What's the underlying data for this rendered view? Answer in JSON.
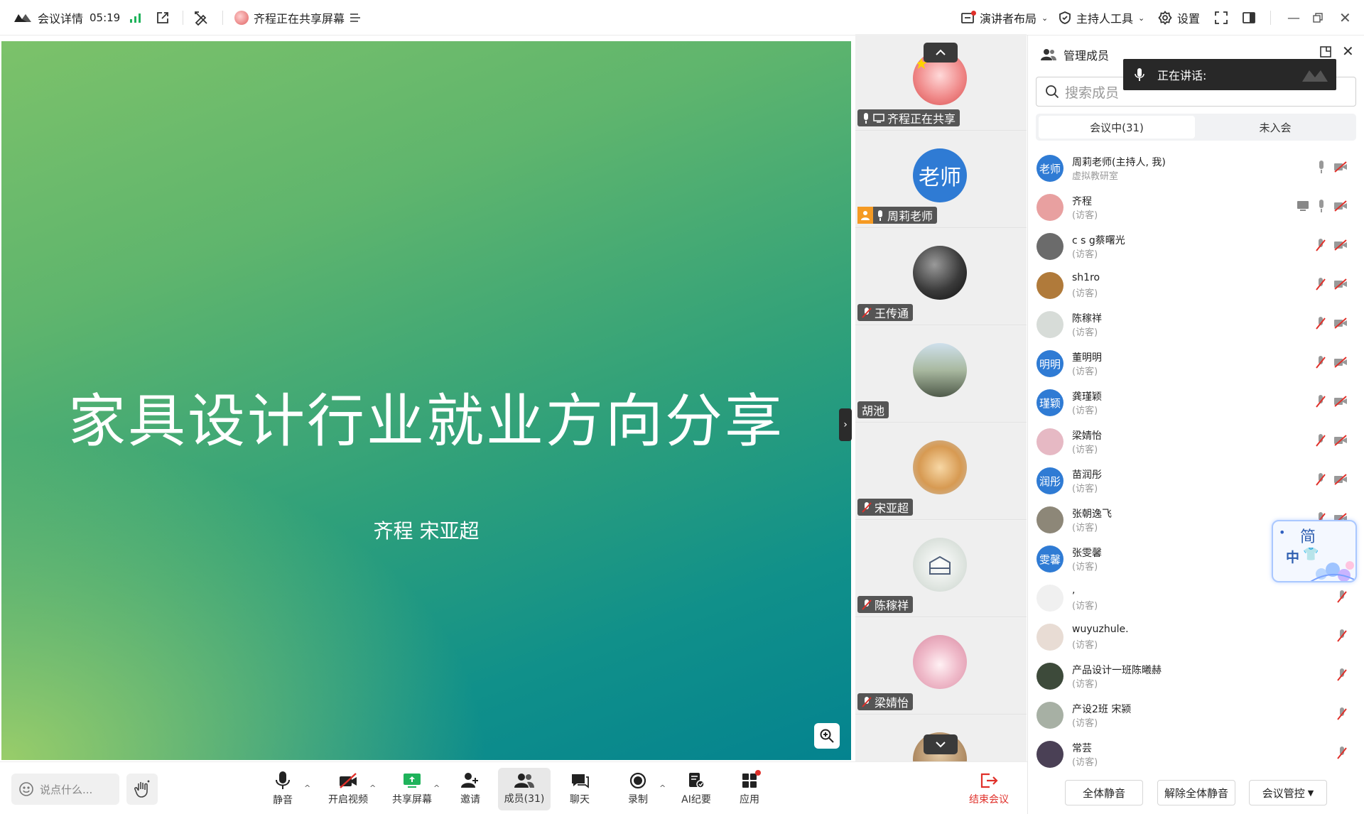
{
  "topbar": {
    "meeting_details": "会议详情",
    "elapsed": "05:19",
    "sharing_status": "齐程正在共享屏幕",
    "presenter_layout": "演讲者布局",
    "host_tools": "主持人工具",
    "settings": "设置"
  },
  "stage": {
    "slide_title": "家具设计行业就业方向分享",
    "slide_subtitle": "齐程 宋亚超"
  },
  "strip": {
    "tiles": [
      {
        "label": "齐程正在共享"
      },
      {
        "label": "周莉老师",
        "avatar_text": "老师"
      },
      {
        "label": "王传通"
      },
      {
        "label": "胡池"
      },
      {
        "label": "宋亚超"
      },
      {
        "label": "陈稼祥"
      },
      {
        "label": "梁婧怡"
      }
    ]
  },
  "panel": {
    "title": "管理成员",
    "speaking_label": "正在讲话:",
    "search_placeholder": "搜索成员",
    "tab_in_meeting": "会议中(31)",
    "tab_not_joined": "未入会",
    "members": [
      {
        "name": "周莉老师(主持人, 我)",
        "role": "虚拟教研室",
        "avatar_text": "老师",
        "avatar_color": "#2f7bd4"
      },
      {
        "name": "齐程",
        "role": "(访客)",
        "avatar_text": "",
        "avatar_color": "#e8a0a0"
      },
      {
        "name": "c s g蔡曙光",
        "role": "(访客)",
        "avatar_text": "",
        "avatar_color": "#6b6b6b"
      },
      {
        "name": "sh1ro",
        "role": "(访客)",
        "avatar_text": "",
        "avatar_color": "#b07a3a"
      },
      {
        "name": "陈稼祥",
        "role": "(访客)",
        "avatar_text": "",
        "avatar_color": "#d7dcd8"
      },
      {
        "name": "董明明",
        "role": "(访客)",
        "avatar_text": "明明",
        "avatar_color": "#2f7bd4"
      },
      {
        "name": "龚瑾颖",
        "role": "(访客)",
        "avatar_text": "瑾颖",
        "avatar_color": "#2f7bd4"
      },
      {
        "name": "梁婧怡",
        "role": "(访客)",
        "avatar_text": "",
        "avatar_color": "#e6b9c4"
      },
      {
        "name": "苗润彤",
        "role": "(访客)",
        "avatar_text": "润彤",
        "avatar_color": "#2f7bd4"
      },
      {
        "name": "张朝逸飞",
        "role": "(访客)",
        "avatar_text": "",
        "avatar_color": "#8d8778"
      },
      {
        "name": "张雯馨",
        "role": "(访客)",
        "avatar_text": "雯馨",
        "avatar_color": "#2f7bd4"
      },
      {
        "name": ",",
        "role": "(访客)",
        "avatar_text": "",
        "avatar_color": "#f0f0f0"
      },
      {
        "name": "wuyuzhule.",
        "role": "(访客)",
        "avatar_text": "",
        "avatar_color": "#e8dcd4"
      },
      {
        "name": "产品设计一班陈曦赫",
        "role": "(访客)",
        "avatar_text": "",
        "avatar_color": "#3d4a3a"
      },
      {
        "name": "产设2班 宋颍",
        "role": "(访客)",
        "avatar_text": "",
        "avatar_color": "#a7b0a4"
      },
      {
        "name": "常芸",
        "role": "(访客)",
        "avatar_text": "",
        "avatar_color": "#4a4055"
      }
    ],
    "mute_all": "全体静音",
    "unmute_all": "解除全体静音",
    "meeting_control": "会议管控"
  },
  "ime_widget": {
    "mode": "简",
    "lang": "中"
  },
  "toolbar": {
    "say_placeholder": "说点什么...",
    "mute": "静音",
    "start_video": "开启视频",
    "share_screen": "共享屏幕",
    "invite": "邀请",
    "members": "成员(31)",
    "chat": "聊天",
    "record": "录制",
    "ai_minutes": "AI纪要",
    "apps": "应用",
    "end_meeting": "结束会议"
  },
  "colors": {
    "accent_blue": "#2f7bd4",
    "end_red": "#e0302a",
    "signal_green": "#1fb35b"
  }
}
